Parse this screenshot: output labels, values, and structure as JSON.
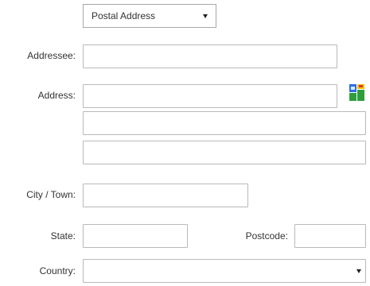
{
  "address_type": {
    "selected": "Postal Address"
  },
  "labels": {
    "addressee": "Addressee:",
    "address": "Address:",
    "city": "City / Town:",
    "state": "State:",
    "postcode": "Postcode:",
    "country": "Country:"
  },
  "fields": {
    "addressee": "",
    "address_line_1": "",
    "address_line_2": "",
    "address_line_3": "",
    "city": "",
    "state": "",
    "postcode": "",
    "country": ""
  },
  "icons": {
    "address_lookup": "google-maps-icon"
  },
  "colors": {
    "field_border": "#b9b9b9",
    "label_text": "#333333",
    "icon_blue": "#2b6ee8",
    "icon_green": "#2e9e3d",
    "icon_yellow": "#f4c20d",
    "icon_red": "#d93b2b"
  }
}
